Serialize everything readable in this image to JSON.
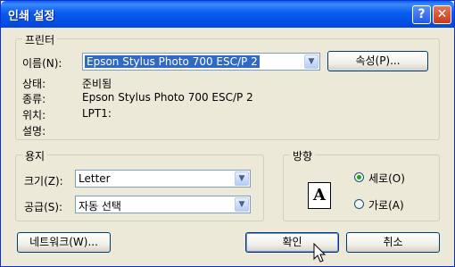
{
  "window": {
    "title": "인쇄 설정",
    "help_label": "?",
    "close_label": "✕"
  },
  "printer": {
    "group_label": "프린터",
    "name_label": "이름(N):",
    "name_value": "Epson Stylus Photo 700 ESC/P 2",
    "properties_button": "속성(P)...",
    "status_label": "상태:",
    "status_value": "준비됨",
    "type_label": "종류:",
    "type_value": "Epson Stylus Photo 700 ESC/P 2",
    "where_label": "위치:",
    "where_value": "LPT1:",
    "comment_label": "설명:",
    "comment_value": ""
  },
  "paper": {
    "group_label": "용지",
    "size_label": "크기(Z):",
    "size_value": "Letter",
    "source_label": "공급(S):",
    "source_value": "자동 선택"
  },
  "orientation": {
    "group_label": "방향",
    "icon_letter": "A",
    "portrait_label": "세로(O)",
    "landscape_label": "가로(A)",
    "selected": "portrait"
  },
  "buttons": {
    "network": "네트워크(W)...",
    "ok": "확인",
    "cancel": "취소"
  },
  "icons": {
    "dropdown": "chevron-down-icon",
    "cursor": "mouse-pointer-icon"
  }
}
